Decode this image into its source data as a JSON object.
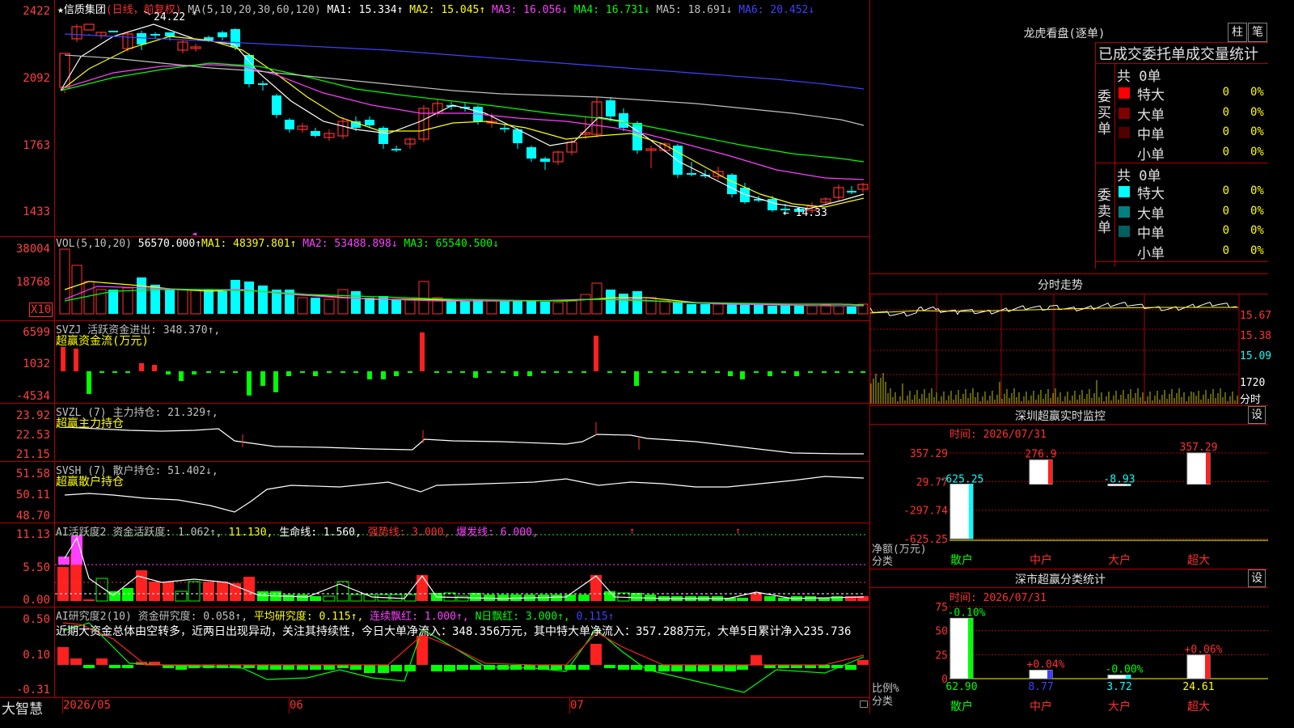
{
  "kline": {
    "star": "★",
    "name": "信质集团",
    "mode": "(日线，前复权)",
    "ma_prefix": "MA(5,10,20,30,60,120)",
    "ma": [
      {
        "label": "MA1: 15.334↑",
        "color": "#ffffff"
      },
      {
        "label": "MA2: 15.045↑",
        "color": "#ffff00"
      },
      {
        "label": "MA3: 16.056↓",
        "color": "#ff40ff"
      },
      {
        "label": "MA4: 16.731↓",
        "color": "#00ff00"
      },
      {
        "label": "MA5: 18.691↓",
        "color": "#c0c0c0"
      },
      {
        "label": "MA6: 20.452↓",
        "color": "#4040ff"
      }
    ],
    "y_labels": [
      "2422",
      "2092",
      "1763",
      "1433"
    ],
    "high_label": "24.22",
    "low_label": "← 14.33"
  },
  "vol": {
    "title": "VOL(5,10,20)",
    "value": "56570.000↑",
    "ma1": "MA1: 48397.801↑",
    "ma2": "MA2: 53488.898↓",
    "ma3": "MA3: 65540.500↓",
    "y_labels": [
      "38004",
      "18768"
    ],
    "unit": "X10"
  },
  "svzj": {
    "title": "SVZJ  活跃资金进出: 348.370↑,",
    "subtitle": "超赢资金流(万元)",
    "y_labels": [
      "6599",
      "1032",
      "-4534"
    ]
  },
  "svzl": {
    "title": "SVZL (7) 主力持仓: 21.329↑,",
    "subtitle": "超赢主力持仓",
    "y_labels": [
      "23.92",
      "22.53",
      "21.15"
    ]
  },
  "svsh": {
    "title": "SVSH (7) 散户持仓: 51.402↓,",
    "subtitle": "超赢散户持仓",
    "y_labels": [
      "51.58",
      "50.11",
      "48.70"
    ]
  },
  "ai_active": {
    "parts": [
      {
        "text": "AI活跃度2 资金活跃度: 1.062↑,",
        "color": "#c0c0c0"
      },
      {
        "text": " 11.130,",
        "color": "#ffff00"
      },
      {
        "text": " 生命线: 1.560,",
        "color": "#ffffff"
      },
      {
        "text": " 强势线: 3.000,",
        "color": "#ff3030"
      },
      {
        "text": " 爆发线: 6.000,",
        "color": "#ff40ff"
      }
    ],
    "y_labels": [
      "11.13",
      "5.50",
      "0.00"
    ]
  },
  "ai_research": {
    "parts": [
      {
        "text": "AI研究度2(10) 资金研究度: 0.058↑,",
        "color": "#c0c0c0"
      },
      {
        "text": " 平均研究度: 0.115↑,",
        "color": "#ffff00"
      },
      {
        "text": " 连续飘红: 1.000↑,",
        "color": "#ff40ff"
      },
      {
        "text": " N日飘红: 3.000↑,",
        "color": "#00ff00"
      },
      {
        "text": " 0.115↑",
        "color": "#4040ff"
      }
    ],
    "comment": "近期大资金总体由空转多，近两日出现异动，关注其持续性，今日大单净流入：348.356万元，其中特大单净流入：357.288万元，大单5日累计净入235.736",
    "y_labels": [
      "0.50",
      "0.10",
      "-0.31"
    ]
  },
  "footer": {
    "brand": "大智慧",
    "dates": [
      "2026/05",
      "06",
      "07"
    ]
  },
  "dragon": {
    "title": "龙虎看盘(逐单)",
    "btn_bar": "柱",
    "btn_pen": "笔",
    "stat_title": "已成交委托单成交量统计",
    "buy_label": "委买单",
    "sell_label": "委卖单",
    "buy_total": "共 0单",
    "sell_total": "共 0单",
    "buy_rows": [
      {
        "label": "特大",
        "color": "#ff0000",
        "count": "0",
        "pct": "0%"
      },
      {
        "label": "大单",
        "color": "#800000",
        "count": "0",
        "pct": "0%"
      },
      {
        "label": "中单",
        "color": "#500000",
        "count": "0",
        "pct": "0%"
      },
      {
        "label": "小单",
        "color": "#000000",
        "count": "0",
        "pct": "0%"
      }
    ],
    "sell_rows": [
      {
        "label": "特大",
        "color": "#00ffff",
        "count": "0",
        "pct": "0%"
      },
      {
        "label": "大单",
        "color": "#008080",
        "count": "0",
        "pct": "0%"
      },
      {
        "label": "中单",
        "color": "#006060",
        "count": "0",
        "pct": "0%"
      },
      {
        "label": "小单",
        "color": "#000000",
        "count": "0",
        "pct": "0%"
      }
    ]
  },
  "intraday": {
    "title": "分时走势",
    "prices": [
      "15.67",
      "15.38",
      "15.09"
    ],
    "vol_label": "1720",
    "vol_unit": "分时"
  },
  "sz_monitor": {
    "title": "深圳超赢实时监控",
    "settings": "设",
    "time": "时间: 2026/07/31",
    "y_labels": [
      "357.29",
      "29.77",
      "-297.74",
      "-625.25"
    ],
    "y_unit": "净额(万元)",
    "x_unit": "分类",
    "chart_data": {
      "type": "bar",
      "categories": [
        "散户",
        "中户",
        "大户",
        "超大"
      ],
      "values": [
        -625.25,
        276.9,
        -8.93,
        357.29
      ],
      "value_labels": [
        "-625.25",
        "276.9",
        "-8.93",
        "357.29"
      ],
      "ylim": [
        -625.25,
        357.29
      ]
    }
  },
  "sz_class": {
    "title": "深市超赢分类统计",
    "settings": "设",
    "time": "时间: 2026/07/31",
    "y_labels": [
      "75",
      "50",
      "25",
      "0"
    ],
    "y_unit": "比例%",
    "x_unit": "分类",
    "chart_data": {
      "type": "bar",
      "categories": [
        "散户",
        "中户",
        "大户",
        "超大"
      ],
      "values": [
        62.9,
        8.77,
        3.72,
        24.61
      ],
      "value_labels": [
        "62.90",
        "8.77",
        "3.72",
        "24.61"
      ],
      "change_labels": [
        "-0.10%",
        "+0.04%",
        "-0.00%",
        "+0.06%"
      ],
      "ylim": [
        0,
        75
      ]
    }
  },
  "colors": {
    "up": "#ff3030",
    "down": "#00ffff",
    "grid": "#b00000"
  }
}
